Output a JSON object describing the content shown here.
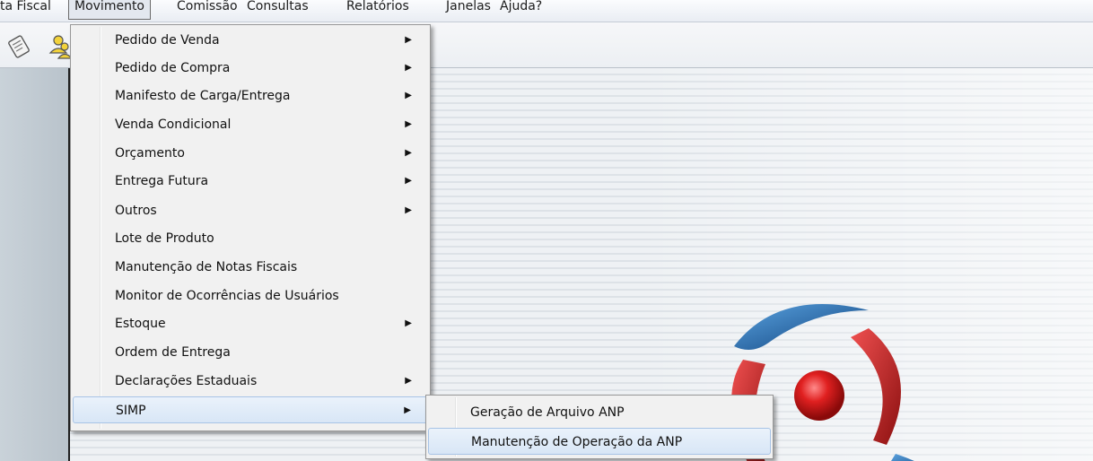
{
  "menubar": {
    "items": [
      {
        "label": "ta Fiscal"
      },
      {
        "label": "Movimento"
      },
      {
        "label": "Comissão"
      },
      {
        "label": "Consultas"
      },
      {
        "label": "Relatórios"
      },
      {
        "label": "Janelas"
      },
      {
        "label": "Ajuda?"
      }
    ],
    "active": "Movimento"
  },
  "toolbar": {
    "icons": [
      "document-icon",
      "users-icon"
    ]
  },
  "menu": {
    "items": [
      {
        "label": "Pedido de Venda",
        "submenu": true
      },
      {
        "label": "Pedido de Compra",
        "submenu": true
      },
      {
        "label": "Manifesto de Carga/Entrega",
        "submenu": true
      },
      {
        "label": "Venda Condicional",
        "submenu": true
      },
      {
        "label": "Orçamento",
        "submenu": true
      },
      {
        "label": "Entrega Futura",
        "submenu": true
      },
      {
        "label": "Outros",
        "submenu": true
      },
      {
        "label": "Lote de Produto",
        "submenu": false
      },
      {
        "label": "Manutenção de Notas Fiscais",
        "submenu": false
      },
      {
        "label": "Monitor de Ocorrências de Usuários",
        "submenu": false
      },
      {
        "label": "Estoque",
        "submenu": true
      },
      {
        "label": "Ordem de Entrega",
        "submenu": false
      },
      {
        "label": "Declarações Estaduais",
        "submenu": true
      },
      {
        "label": "SIMP",
        "submenu": true,
        "highlighted": true
      }
    ],
    "arrow_glyph": "▶"
  },
  "submenu": {
    "items": [
      {
        "label": "Geração de Arquivo ANP"
      },
      {
        "label": "Manutenção de Operação da ANP",
        "highlighted": true
      }
    ]
  },
  "colors": {
    "highlight": "#d8e6f6",
    "logo_red": "#d62a2a",
    "logo_blue": "#1f6fb5"
  }
}
